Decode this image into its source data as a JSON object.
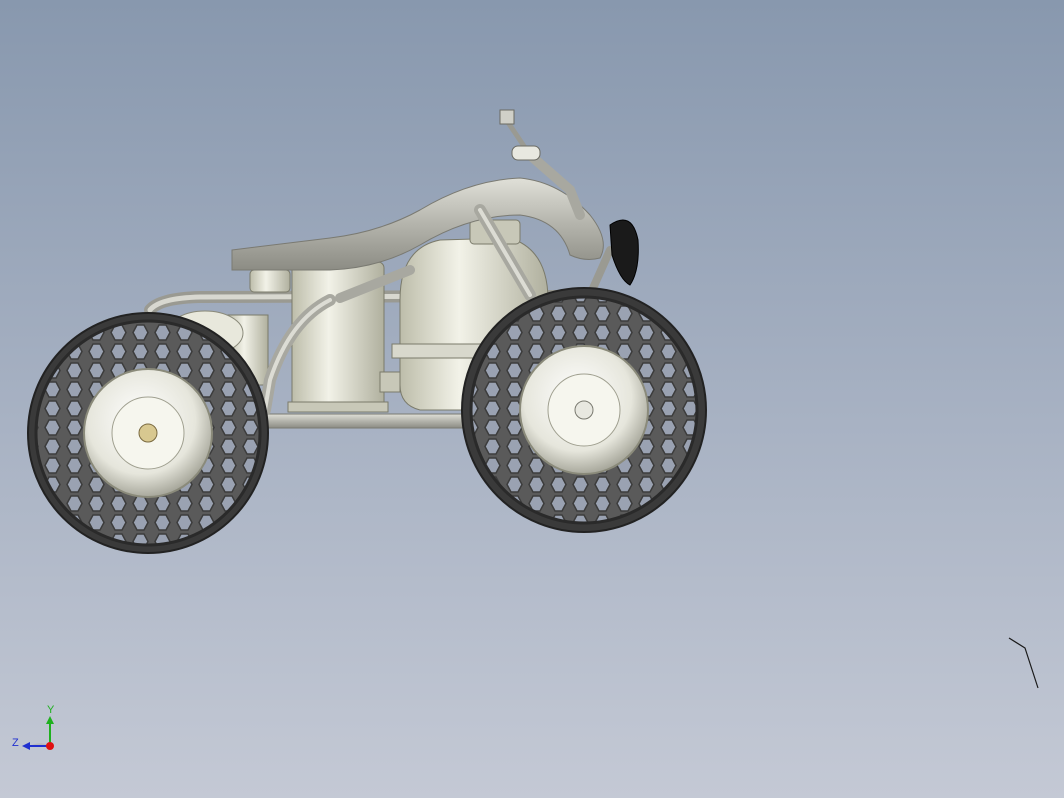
{
  "viewport": {
    "background_top": "#8898ae",
    "background_bottom": "#c4c9d5",
    "model": "atv-quad-bike",
    "view": "side"
  },
  "triad": {
    "y_label": "Y",
    "z_label": "Z",
    "y_color": "#1fb01f",
    "z_color": "#2030d0",
    "x_color": "#e01010"
  },
  "colors": {
    "metal": "#dcdccc",
    "tube": "#b8b8b0",
    "tire": "#4a4a4a",
    "spring": "#c03020"
  }
}
